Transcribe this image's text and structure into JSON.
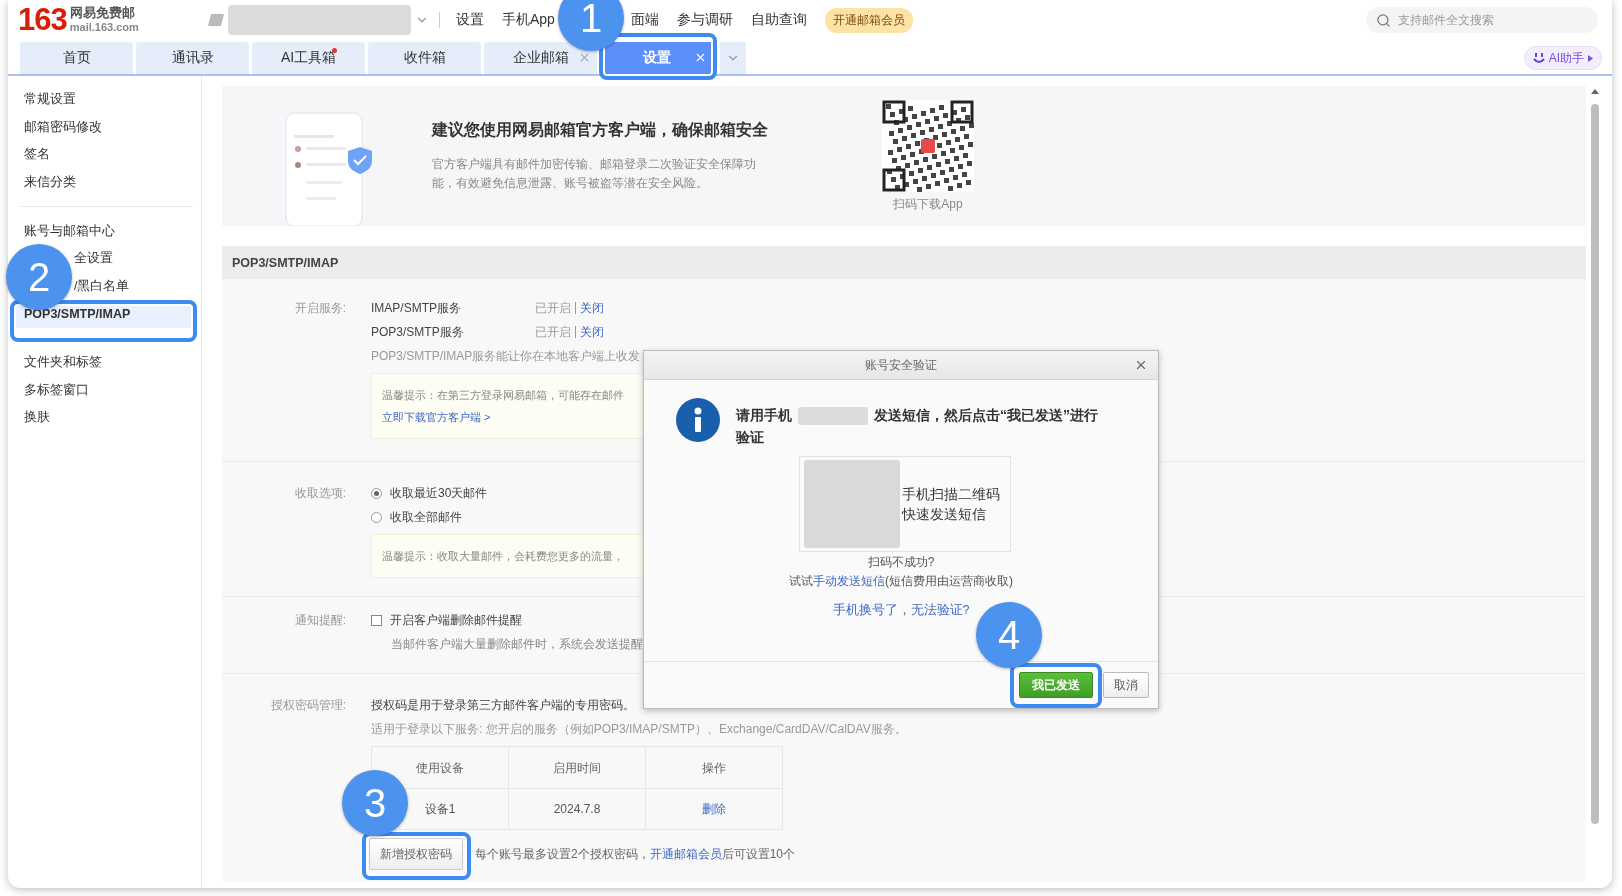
{
  "header": {
    "logo_number": "163",
    "logo_name": "网易免费邮",
    "logo_domain": "mail.163.com",
    "nav": [
      "设置",
      "手机App",
      "面端",
      "参与调研",
      "自助查询"
    ],
    "vip_pill": "开通邮箱会员",
    "search": {
      "placeholder": "支持邮件全文搜索"
    }
  },
  "tabs": [
    {
      "label": "首页",
      "selected": false,
      "closable": false,
      "dot": false
    },
    {
      "label": "通讯录",
      "selected": false,
      "closable": false,
      "dot": false
    },
    {
      "label": "AI工具箱",
      "selected": false,
      "closable": false,
      "dot": true
    },
    {
      "label": "收件箱",
      "selected": false,
      "closable": false,
      "dot": false
    },
    {
      "label": "企业邮箱",
      "selected": false,
      "closable": true,
      "dot": false
    },
    {
      "label": "设置",
      "selected": true,
      "closable": true,
      "dot": false
    }
  ],
  "ai_button": "AI助手",
  "sidebar": {
    "groups": [
      [
        {
          "label": "常规设置",
          "selected": false,
          "covered": false
        },
        {
          "label": "邮箱密码修改",
          "selected": false,
          "covered": false
        },
        {
          "label": "签名",
          "selected": false,
          "covered": false
        },
        {
          "label": "来信分类",
          "selected": false,
          "covered": false
        }
      ],
      [
        {
          "label": "账号与邮箱中心",
          "selected": false,
          "covered": false
        },
        {
          "label": "全设置",
          "selected": false,
          "covered": true
        },
        {
          "label": "/黑白名单",
          "selected": false,
          "covered": true
        },
        {
          "label": "POP3/SMTP/IMAP",
          "selected": true,
          "covered": false
        }
      ],
      [
        {
          "label": "文件夹和标签",
          "selected": false,
          "covered": false
        },
        {
          "label": "多标签窗口",
          "selected": false,
          "covered": false
        },
        {
          "label": "换肤",
          "selected": false,
          "covered": false
        }
      ]
    ]
  },
  "banner": {
    "title": "建议您使用网易邮箱官方客户端，确保邮箱安全",
    "text": "官方客户端具有邮件加密传输、邮箱登录二次验证安全保障功能，有效避免信息泄露、账号被盗等潜在安全风险。",
    "qr_caption": "扫码下载App"
  },
  "section_title": "POP3/SMTP/IMAP",
  "services": {
    "label": "开启服务:",
    "items": [
      {
        "name": "IMAP/SMTP服务",
        "status": "已开启",
        "action": "关闭"
      },
      {
        "name": "POP3/SMTP服务",
        "status": "已开启",
        "action": "关闭"
      }
    ],
    "description": "POP3/SMTP/IMAP服务能让你在本地客户端上收发",
    "tip": "温馨提示：在第三方登录网易邮箱，可能存在邮件",
    "tip_link": "立即下载官方客户端 >"
  },
  "fetch": {
    "label": "收取选项:",
    "options": [
      {
        "label": "收取最近30天邮件",
        "selected": true
      },
      {
        "label": "收取全部邮件",
        "selected": false
      }
    ],
    "tip": "温馨提示：收取大量邮件，会耗费您更多的流量，"
  },
  "notify": {
    "label": "通知提醒:",
    "checkbox": {
      "label": "开启客户端删除邮件提醒",
      "checked": false
    },
    "hint": "当邮件客户端大量删除邮件时，系统会发送提醒"
  },
  "auth": {
    "label": "授权密码管理:",
    "line1": "授权码是用于登录第三方邮件客户端的专用密码。",
    "line2": "适用于登录以下服务: 您开启的服务（例如POP3/IMAP/SMTP）、Exchange/CardDAV/CalDAV服务。",
    "table": {
      "columns": [
        "使用设备",
        "启用时间",
        "操作"
      ],
      "rows": [
        {
          "device": "设备1",
          "time": "2024.7.8",
          "action": "删除"
        }
      ]
    },
    "add_button": "新增授权密码",
    "note_before": "每个账号最多设置2个授权密码，",
    "note_link": "开通邮箱会员",
    "note_after": "后可设置10个"
  },
  "dialog": {
    "title": "账号安全验证",
    "message_before": "请用手机",
    "message_after": "发送短信，然后点击“我已发送”进行验证",
    "qr_lines": [
      "手机扫描二维码",
      "快速发送短信"
    ],
    "fail_text": "扫码不成功?",
    "try_before": "试试",
    "try_link": "手动发送短信",
    "try_after": "(短信费用由运营商收取)",
    "help_link": "手机换号了，无法验证?",
    "primary_button": "我已发送",
    "cancel_button": "取消"
  },
  "annotations": [
    {
      "number": "1"
    },
    {
      "number": "2"
    },
    {
      "number": "3"
    },
    {
      "number": "4"
    }
  ]
}
